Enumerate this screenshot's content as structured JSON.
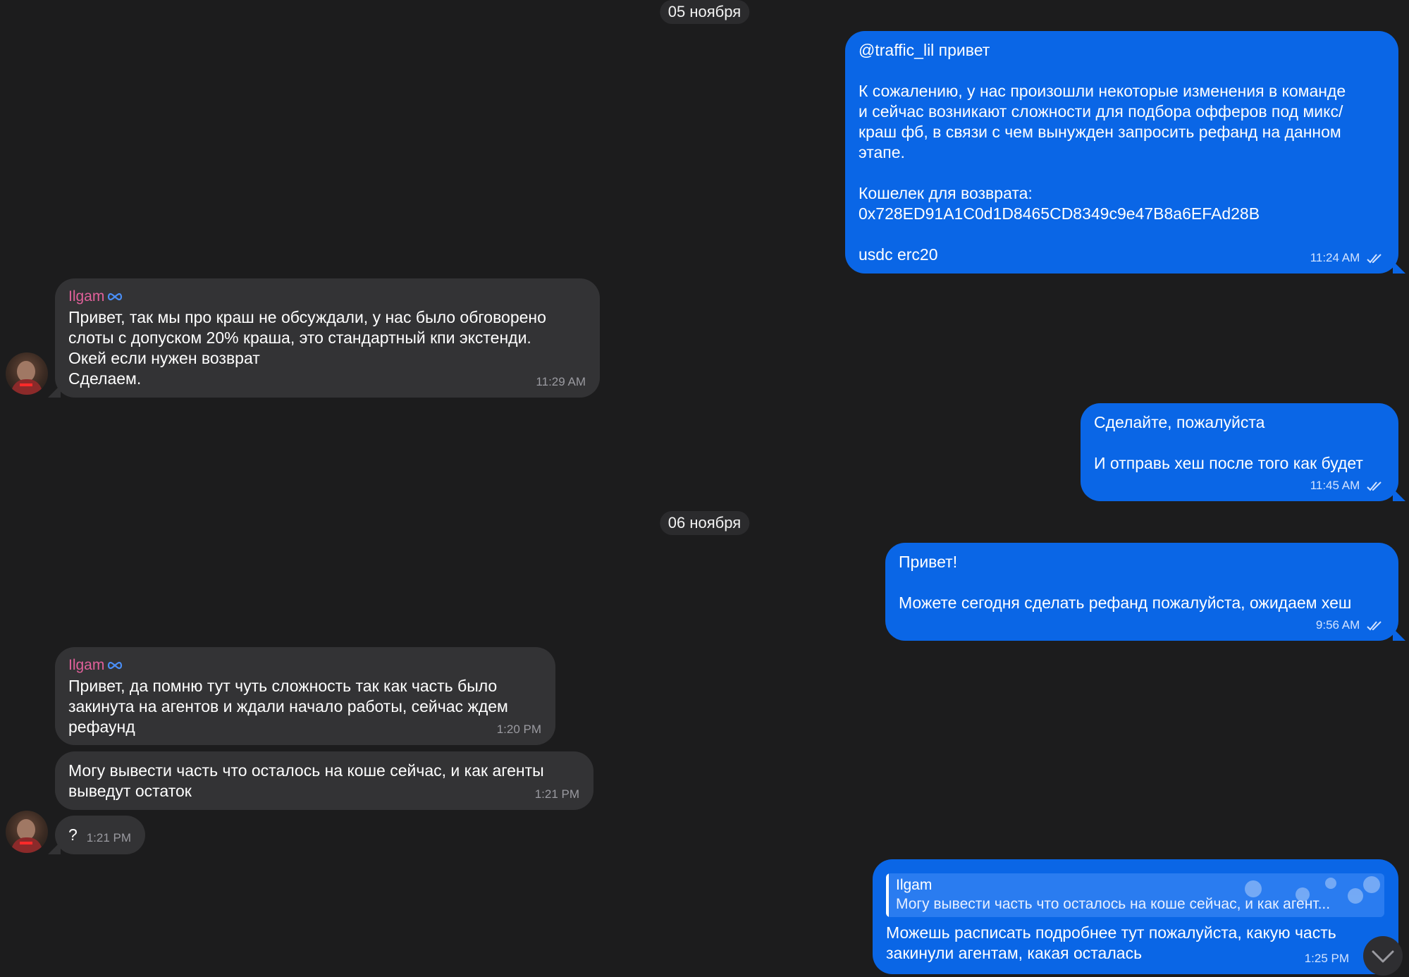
{
  "dates": {
    "nov5": "05 ноября",
    "nov6": "06 ноября"
  },
  "contact": {
    "name": "Ilgam",
    "badge_icon": "meta-infinity-icon",
    "name_color": "#e0609a"
  },
  "colors": {
    "background": "#1c1c1d",
    "outgoing_bubble": "#0a66e6",
    "incoming_bubble": "#333335"
  },
  "messages": [
    {
      "direction": "out",
      "lines": [
        "@traffic_lil привет",
        "",
        "К сожалению, у нас произошли некоторые изменения в команде",
        "и сейчас возникают сложности для подбора офферов под микс/",
        "краш фб, в связи с чем вынужден запросить рефанд на данном",
        "этапе.",
        "",
        "Кошелек для возврата:",
        "0x728ED91A1C0d1D8465CD8349c9e47B8a6EFAd28B",
        "",
        "usdc erc20"
      ],
      "time": "11:24 AM",
      "status": "read"
    },
    {
      "direction": "in",
      "sender": "Ilgam",
      "lines": [
        "Привет, так мы про краш не обсуждали, у нас было обговорено",
        "слоты с допуском 20% краша, это стандартный кпи экстенди.",
        "Окей если нужен возврат",
        "Сделаем."
      ],
      "time": "11:29 AM"
    },
    {
      "direction": "out",
      "lines": [
        "Сделайте, пожалуйста",
        "",
        "И отправь хеш после того как будет"
      ],
      "time": "11:45 AM",
      "status": "read"
    },
    {
      "direction": "out",
      "lines": [
        "Привет!",
        "",
        "Можете сегодня сделать рефанд пожалуйста, ожидаем хеш"
      ],
      "time": "9:56 AM",
      "status": "read"
    },
    {
      "direction": "in",
      "sender": "Ilgam",
      "lines": [
        "Привет, да помню тут чуть сложность так как часть было",
        "закинута на агентов и ждали начало работы, сейчас ждем",
        "рефаунд"
      ],
      "time": "1:20 PM"
    },
    {
      "direction": "in",
      "lines": [
        "Могу вывести часть что осталось на коше сейчас, и как агенты",
        "выведут остаток"
      ],
      "time": "1:21 PM"
    },
    {
      "direction": "in",
      "lines": [
        "?"
      ],
      "time": "1:21 PM"
    },
    {
      "direction": "out",
      "reply": {
        "author": "Ilgam",
        "text": "Могу вывести часть что осталось на коше сейчас, и как агент..."
      },
      "lines": [
        "Можешь расписать подробнее тут пожалуйста, какую часть",
        "закинули агентам, какая осталась"
      ],
      "time": "1:25 PM"
    }
  ],
  "scroll_button": {
    "icon": "chevron-down-icon"
  }
}
